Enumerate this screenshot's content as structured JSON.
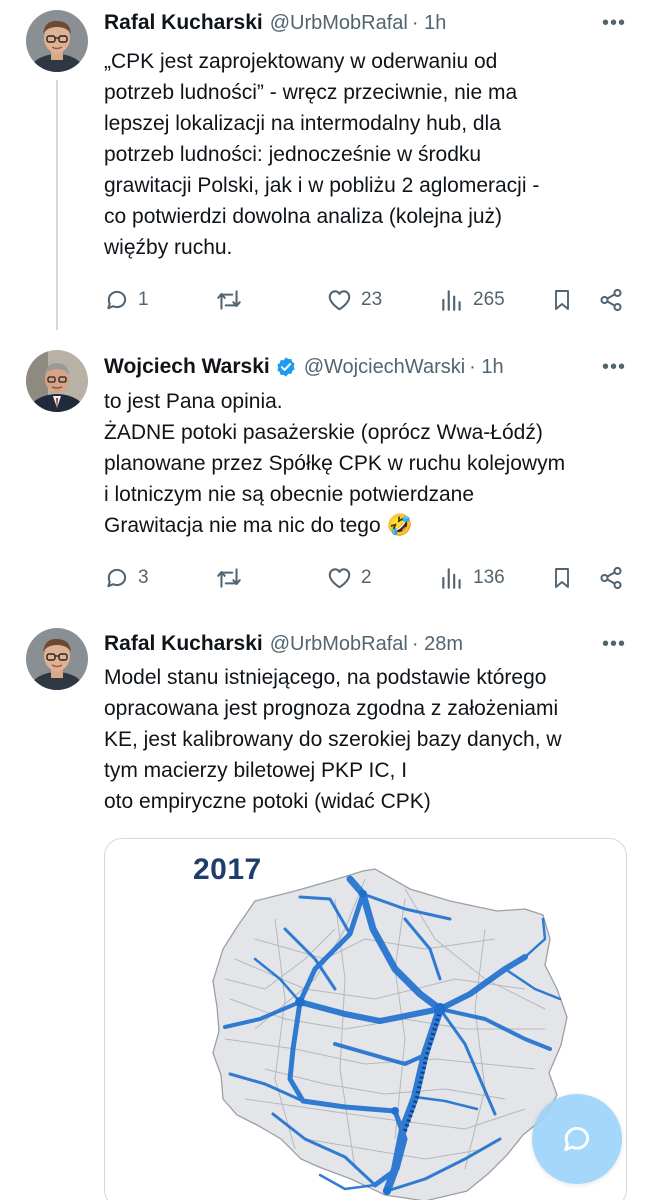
{
  "tweets": [
    {
      "name": "Rafal Kucharski",
      "handle": "@UrbMobRafal",
      "time": "· 1h",
      "more": "•••",
      "lines": [
        "„CPK jest zaprojektowany w oderwaniu od",
        "potrzeb ludności” - wręcz przeciwnie, nie ma",
        "lepszej lokalizacji na intermodalny hub, dla",
        "potrzeb ludności: jednocześnie w środku",
        "grawitacji  Polski, jak i w pobliżu 2 aglomeracji -",
        "co potwierdzi dowolna analiza (kolejna już)",
        "więźby ruchu."
      ],
      "replies": "1",
      "likes": "23",
      "views": "265"
    },
    {
      "name": "Wojciech Warski",
      "handle": "@WojciechWarski",
      "time": "· 1h",
      "more": "•••",
      "lines": [
        "to jest Pana opinia.",
        "ŻADNE potoki pasażerskie (oprócz Wwa-Łódź)",
        "planowane przez Spółkę CPK w ruchu kolejowym",
        "i lotniczym nie są obecnie potwierdzane",
        "Grawitacja nie ma nic do tego 🤣"
      ],
      "replies": "3",
      "likes": "2",
      "views": "136"
    },
    {
      "name": "Rafal Kucharski",
      "handle": "@UrbMobRafal",
      "time": "· 28m",
      "more": "•••",
      "lines": [
        "Model stanu istniejącego, na podstawie którego",
        "opracowana jest prognoza zgodna z założeniami",
        "KE, jest kalibrowany do szerokiej bazy danych, w",
        "tym macierzy biletowej PKP IC, I",
        "oto empiryczne potoki (widać CPK)"
      ],
      "media_label": "2017"
    }
  ],
  "colors": {
    "text": "#0f1419",
    "secondary": "#536471",
    "verified": "#1d9bf0",
    "flow": "#1d6fd0",
    "fab": "#9bd3f9"
  }
}
